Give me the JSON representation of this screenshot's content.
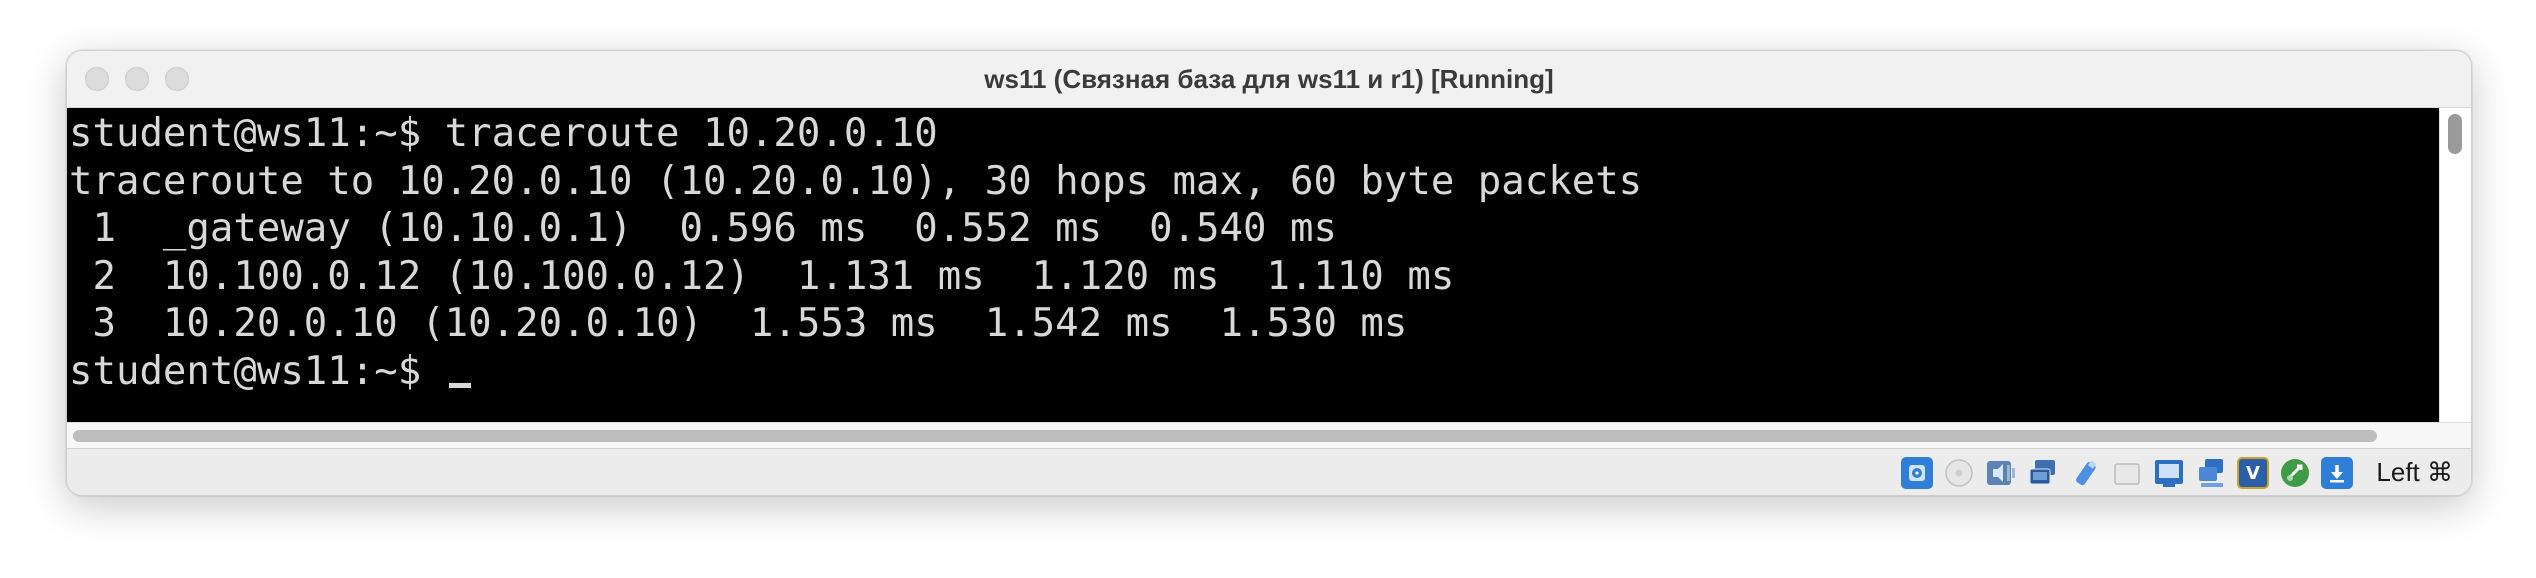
{
  "window": {
    "title": "ws11 (Связная база для ws11 и r1) [Running]"
  },
  "terminal": {
    "lines": [
      "student@ws11:~$ traceroute 10.20.0.10",
      "traceroute to 10.20.0.10 (10.20.0.10), 30 hops max, 60 byte packets",
      " 1  _gateway (10.10.0.1)  0.596 ms  0.552 ms  0.540 ms",
      " 2  10.100.0.12 (10.100.0.12)  1.131 ms  1.120 ms  1.110 ms",
      " 3  10.20.0.10 (10.20.0.10)  1.553 ms  1.542 ms  1.530 ms",
      "student@ws11:~$ "
    ],
    "text_color": "#d8d8d8",
    "background": "#000000"
  },
  "statusbar": {
    "icons": [
      {
        "name": "hard-disk-icon"
      },
      {
        "name": "optical-drive-icon"
      },
      {
        "name": "audio-icon"
      },
      {
        "name": "network-icon"
      },
      {
        "name": "usb-icon"
      },
      {
        "name": "shared-folders-icon"
      },
      {
        "name": "display-icon"
      },
      {
        "name": "video-capture-icon"
      },
      {
        "name": "virtualization-icon",
        "glyph": "V"
      },
      {
        "name": "mouse-integration-icon"
      },
      {
        "name": "keyboard-capture-icon"
      }
    ],
    "host_key": "Left ⌘"
  }
}
